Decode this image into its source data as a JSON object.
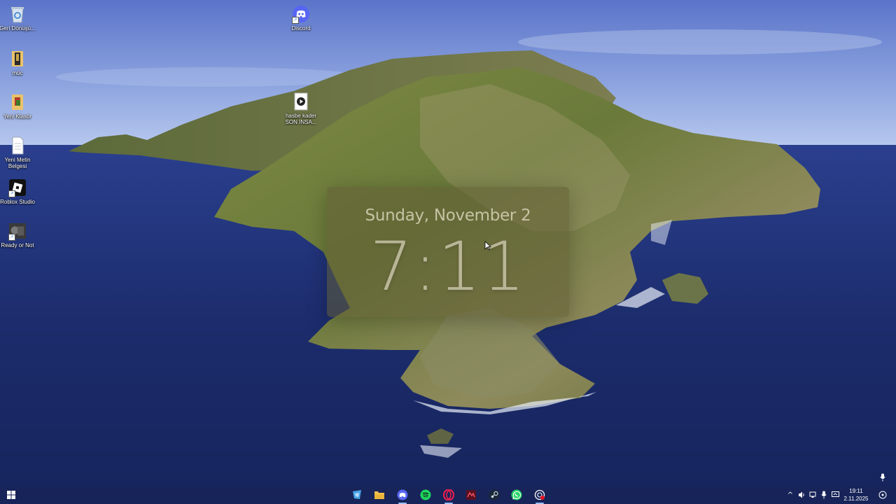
{
  "desktop": {
    "icons": [
      {
        "name": "recycle-bin",
        "label": "Geri Dönüşü..."
      },
      {
        "name": "music-folder",
        "label": "müc"
      },
      {
        "name": "new-folder",
        "label": "Yeni Klasör"
      },
      {
        "name": "new-text-document",
        "label": "Yeni Metin Belgesi"
      },
      {
        "name": "roblox-studio",
        "label": "Roblox Studio"
      },
      {
        "name": "ready-or-not",
        "label": "Ready or Not"
      },
      {
        "name": "discord",
        "label": "Discord"
      },
      {
        "name": "video-file",
        "label": "hasbe kader SON İNSA..."
      }
    ]
  },
  "clock_widget": {
    "date": "Sunday, November 2",
    "time": "7:11"
  },
  "taskbar": {
    "apps": [
      "start-icon",
      "file-explorer-alt-icon",
      "file-explorer-icon",
      "discord-icon",
      "spotify-icon",
      "opera-gx-icon",
      "media-icon",
      "steam-icon",
      "whatsapp-icon",
      "recorder-icon"
    ],
    "tray": {
      "time": "19:11",
      "date": "2.11.2025"
    }
  },
  "colors": {
    "taskbar": "#1a2654",
    "widget_bg": "#605c34",
    "widget_text": "#c7c3a4"
  }
}
